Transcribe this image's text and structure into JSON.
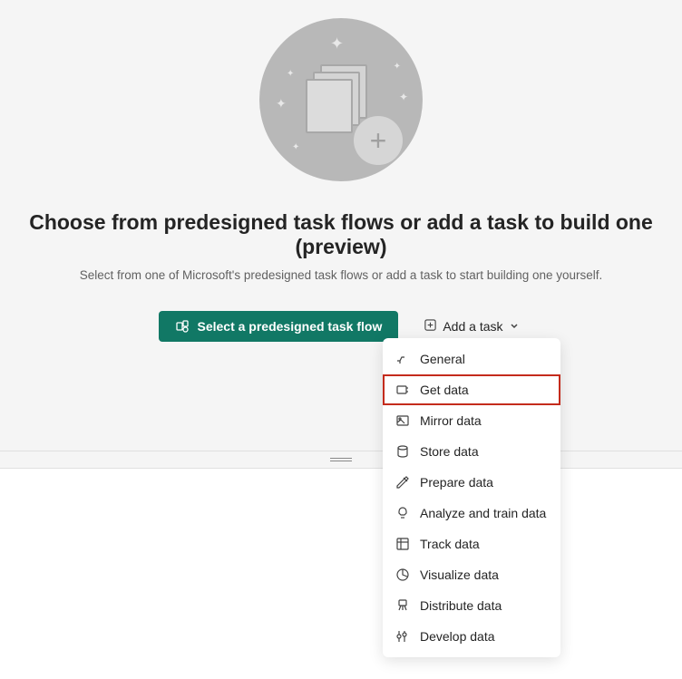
{
  "hero": {
    "title": "Choose from predesigned task flows or add a task to build one (preview)",
    "subtitle": "Select from one of Microsoft's predesigned task flows or add a task to start building one yourself."
  },
  "actions": {
    "primary_label": "Select a predesigned task flow",
    "secondary_label": "Add a task"
  },
  "dropdown": {
    "items": [
      {
        "label": "General"
      },
      {
        "label": "Get data"
      },
      {
        "label": "Mirror data"
      },
      {
        "label": "Store data"
      },
      {
        "label": "Prepare data"
      },
      {
        "label": "Analyze and train data"
      },
      {
        "label": "Track data"
      },
      {
        "label": "Visualize data"
      },
      {
        "label": "Distribute data"
      },
      {
        "label": "Develop data"
      }
    ],
    "highlighted_index": 1
  }
}
